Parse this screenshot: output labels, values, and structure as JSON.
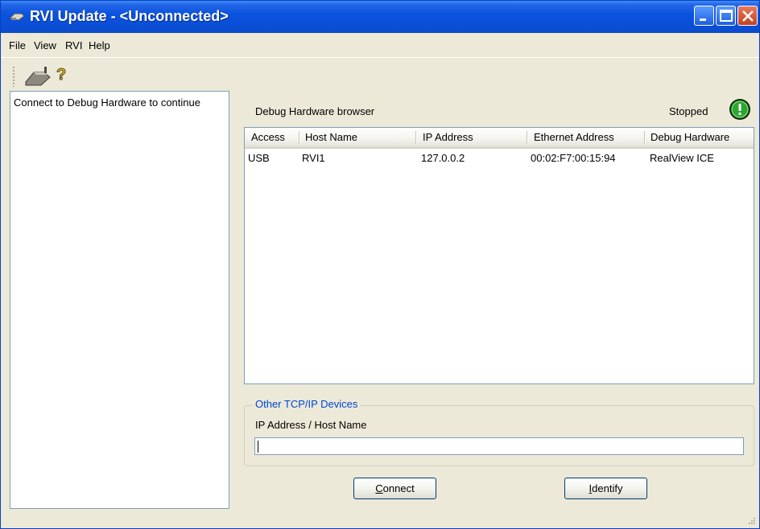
{
  "window": {
    "title": "RVI Update - <Unconnected>",
    "icon": "rvi-app-icon",
    "controls": [
      "minimize-icon",
      "maximize-icon",
      "close-icon"
    ]
  },
  "menu": {
    "items": [
      {
        "label": "File"
      },
      {
        "label": "View"
      },
      {
        "label": "RVI"
      },
      {
        "label": "Help"
      }
    ]
  },
  "toolbar": {
    "icons": [
      "connect-plug-icon",
      "help-question-icon"
    ]
  },
  "left_pane": {
    "message": "Connect to Debug Hardware to continue"
  },
  "browser": {
    "title": "Debug Hardware browser",
    "status": "Stopped",
    "status_icon": "stopped-status-icon",
    "columns": [
      "Access",
      "Host Name",
      "IP Address",
      "Ethernet Address",
      "Debug Hardware"
    ],
    "rows": [
      {
        "access": "USB",
        "host_name": "RVI1",
        "ip_address": "127.0.0.2",
        "ethernet_address": "00:02:F7:00:15:94",
        "debug_hardware": "RealView ICE"
      }
    ]
  },
  "tcp_group": {
    "legend": "Other TCP/IP Devices",
    "label": "IP Address / Host Name",
    "value": ""
  },
  "buttons": {
    "connect": {
      "accel": "C",
      "rest": "onnect"
    },
    "identify": {
      "accel": "I",
      "rest": "dentify"
    }
  },
  "colors": {
    "titlebar": "#0b53df",
    "window_bg": "#ece9d8",
    "legend": "#0046d5",
    "status_green": "#1a7a1a"
  }
}
